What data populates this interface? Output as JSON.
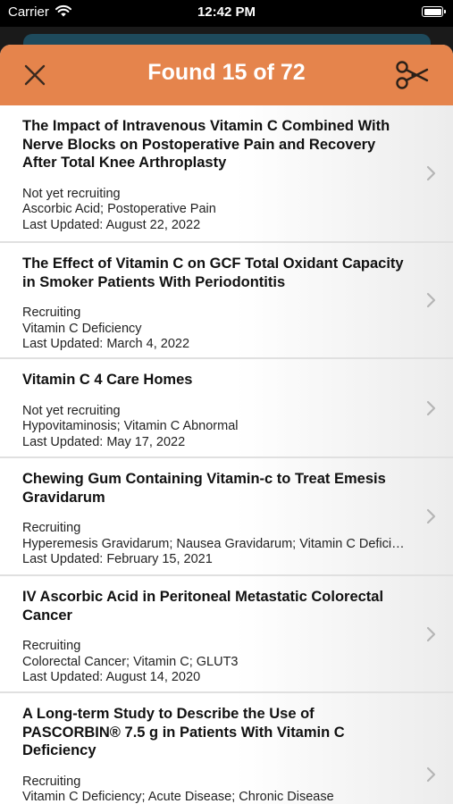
{
  "status_bar": {
    "carrier": "Carrier",
    "time": "12:42 PM"
  },
  "header": {
    "title": "Found 15 of 72",
    "accent_color": "#e5844c"
  },
  "trials": [
    {
      "title": "The Impact of Intravenous Vitamin C Combined With Nerve Blocks on Postoperative Pain and Recovery After Total Knee Arthroplasty",
      "status": "Not yet recruiting",
      "conditions": "Ascorbic Acid; Postoperative Pain",
      "updated": "Last Updated: August 22, 2022"
    },
    {
      "title": "The Effect of Vitamin C on GCF Total Oxidant Capacity in Smoker Patients With Periodontitis",
      "status": "Recruiting",
      "conditions": "Vitamin C Deficiency",
      "updated": "Last Updated: March 4, 2022"
    },
    {
      "title": "Vitamin C 4 Care Homes",
      "status": "Not yet recruiting",
      "conditions": "Hypovitaminosis; Vitamin C Abnormal",
      "updated": "Last Updated: May 17, 2022"
    },
    {
      "title": "Chewing Gum Containing Vitamin-c to Treat Emesis Gravidarum",
      "status": "Recruiting",
      "conditions": "Hyperemesis Gravidarum; Nausea Gravidarum; Vitamin C Defici…",
      "updated": "Last Updated: February 15, 2021"
    },
    {
      "title": "IV Ascorbic Acid in Peritoneal Metastatic Colorectal Cancer",
      "status": "Recruiting",
      "conditions": "Colorectal Cancer; Vitamin C; GLUT3",
      "updated": "Last Updated: August 14, 2020"
    },
    {
      "title": "A Long-term Study to Describe the Use of PASCORBIN® 7.5 g in Patients With Vitamin C Deficiency",
      "status": "Recruiting",
      "conditions": "Vitamin C Deficiency; Acute Disease; Chronic Disease",
      "updated": ""
    }
  ]
}
